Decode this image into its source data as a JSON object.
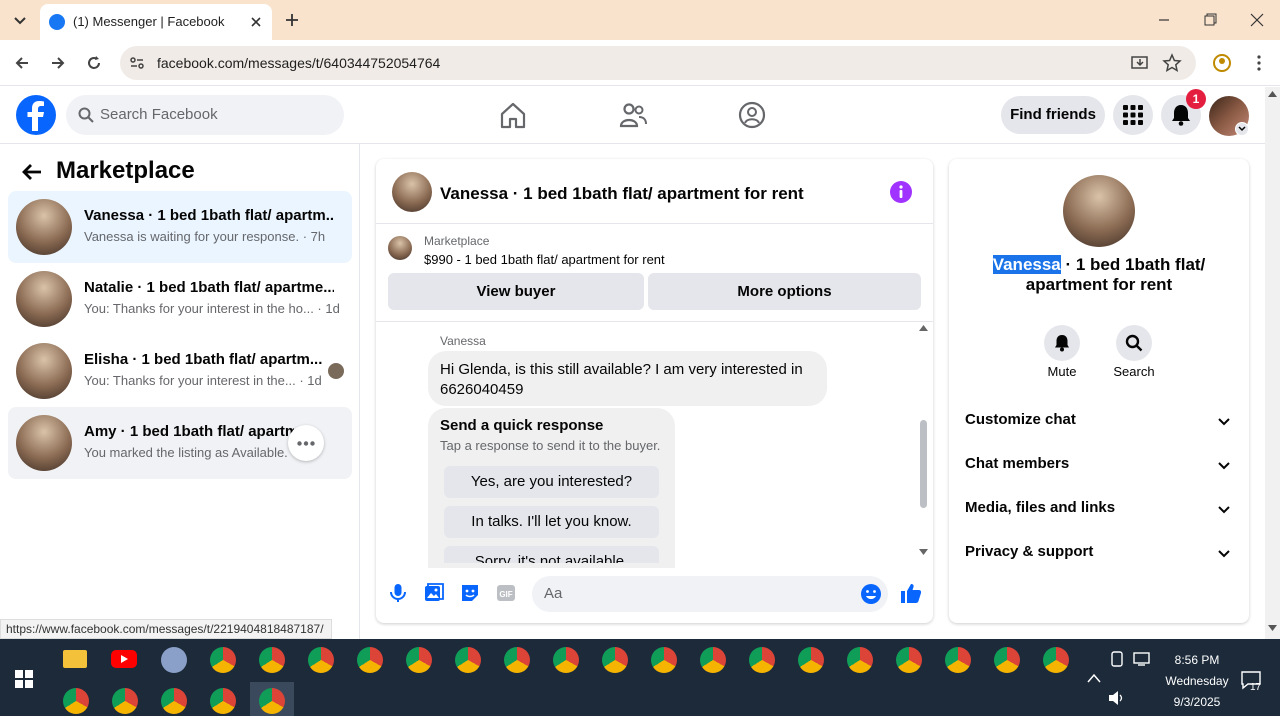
{
  "browser": {
    "tab_title": "(1) Messenger | Facebook",
    "url": "facebook.com/messages/t/640344752054764",
    "status_url": "https://www.facebook.com/messages/t/2219404818487187/"
  },
  "header": {
    "search_placeholder": "Search Facebook",
    "find_friends": "Find friends",
    "notification_count": "1"
  },
  "sidebar": {
    "title": "Marketplace",
    "conversations": [
      {
        "name": "Vanessa · 1 bed 1bath flat/ apartm...",
        "snippet": "Vanessa is waiting for your response. · 7h"
      },
      {
        "name": "Natalie · 1 bed 1bath flat/ apartme...",
        "snippet": "You: Thanks for your interest in the ho... · 1d"
      },
      {
        "name": "Elisha · 1 bed 1bath flat/ apartm...",
        "snippet": "You: Thanks for your interest in the... · 1d"
      },
      {
        "name": "Amy · 1 bed 1bath flat/ apartm...",
        "snippet": "You marked the listing as Available. ·"
      }
    ]
  },
  "chat": {
    "title": "Vanessa · 1 bed 1bath flat/ apartment for rent",
    "listing_label": "Marketplace",
    "listing_price": "$990 - 1 bed 1bath flat/ apartment for rent",
    "view_buyer": "View buyer",
    "more_options": "More options",
    "sender": "Vanessa",
    "message": "Hi Glenda, is this still available?  I am very interested in 6626040459",
    "quick_title": "Send a quick response",
    "quick_sub": "Tap a response to send it to the buyer.",
    "quick_responses": [
      "Yes, are you interested?",
      "In talks. I'll let you know.",
      "Sorry, it's not available."
    ],
    "composer_placeholder": "Aa"
  },
  "details": {
    "name_highlight": "Vanessa",
    "name_rest_line1": " · 1 bed 1bath flat/",
    "name_line2": "apartment for rent",
    "mute": "Mute",
    "search": "Search",
    "sections": [
      "Customize chat",
      "Chat members",
      "Media, files and links",
      "Privacy & support"
    ]
  },
  "taskbar": {
    "time": "8:56 PM",
    "day": "Wednesday",
    "date": "9/3/2025",
    "notifications": "17"
  },
  "colors": {
    "accent": "#0866ff",
    "info": "#a033ff",
    "taskbar": "#1c2a3a"
  }
}
